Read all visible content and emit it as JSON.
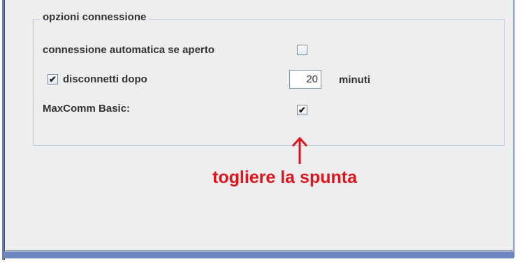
{
  "group": {
    "title": "opzioni connessione"
  },
  "options": {
    "auto_connect_label": "connessione automatica se aperto",
    "auto_connect_checked": false,
    "disconnect_label": "disconnetti dopo",
    "disconnect_checked": true,
    "disconnect_minutes": "20",
    "minutes_unit": "minuti",
    "maxcomm_label": "MaxComm Basic:",
    "maxcomm_checked": true
  },
  "annotation": {
    "text": "togliere la spunta",
    "color": "#e0141e"
  },
  "check_glyph": "✔"
}
